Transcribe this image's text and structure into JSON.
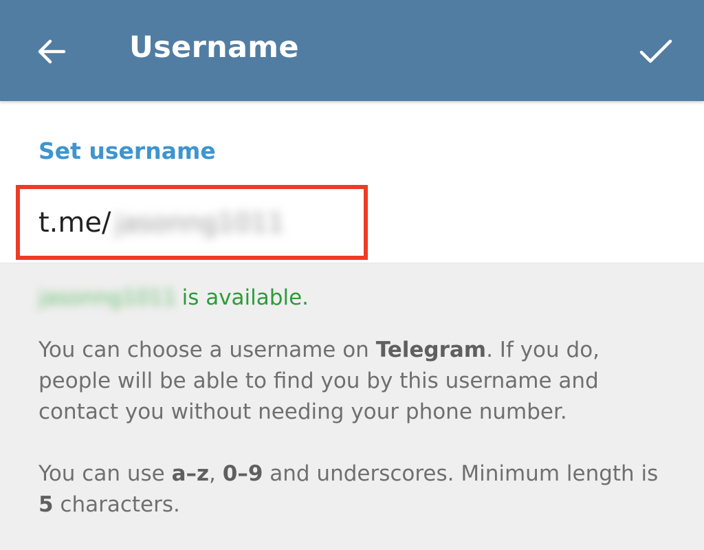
{
  "appbar": {
    "title": "Username",
    "back_icon": "arrow-left-icon",
    "confirm_icon": "checkmark-icon",
    "color": "#517da2"
  },
  "username_section": {
    "header": "Set username",
    "prefix": "t.me/",
    "value": "jasonng1011",
    "header_color": "#3e95cf",
    "highlight_color": "#ef3b24"
  },
  "status": {
    "name": "jasonng1011",
    "message": "is available.",
    "color": "#2e9a3a"
  },
  "help": {
    "p1_part1": "You can choose a username on ",
    "p1_bold": "Telegram",
    "p1_part2": ". If you do, people will be able to find you by this username and contact you without needing your phone number.",
    "p2_part1": "You can use ",
    "p2_bold1": "a–z",
    "p2_sep1": ", ",
    "p2_bold2": "0–9",
    "p2_part2": " and underscores. Minimum length is ",
    "p2_bold3": "5",
    "p2_part3": " characters."
  }
}
